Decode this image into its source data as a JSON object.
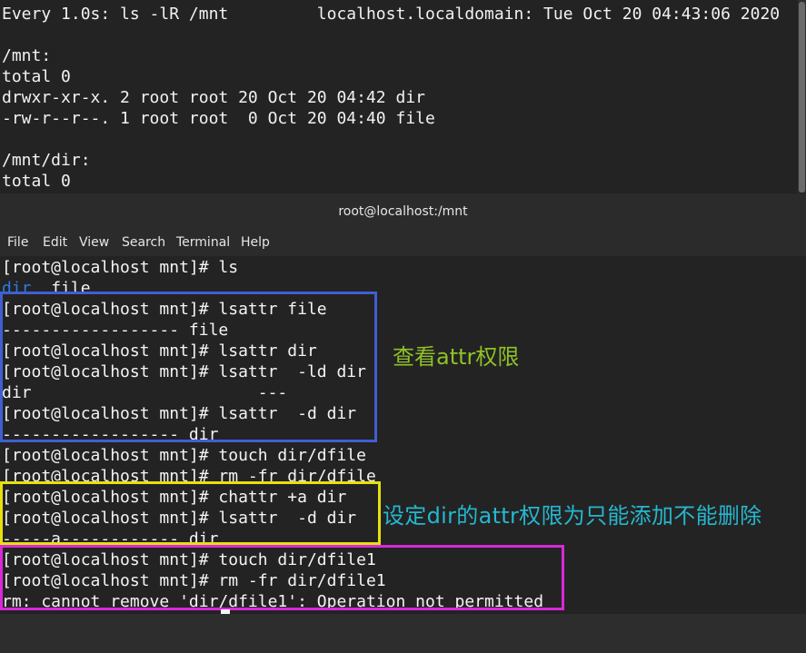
{
  "watch_terminal": {
    "lines": [
      "Every 1.0s: ls -lR /mnt         localhost.localdomain: Tue Oct 20 04:43:06 2020",
      "",
      "/mnt:",
      "total 0",
      "drwxr-xr-x. 2 root root 20 Oct 20 04:42 dir",
      "-rw-r--r--. 1 root root  0 Oct 20 04:40 file",
      "",
      "/mnt/dir:",
      "total 0"
    ]
  },
  "window": {
    "title": "root@localhost:/mnt",
    "menu": [
      "File",
      "Edit",
      "View",
      "Search",
      "Terminal",
      "Help"
    ]
  },
  "terminal": {
    "prompt_ls": "[root@localhost mnt]# ls",
    "ls_output": {
      "dir": "dir",
      "file": "  file"
    },
    "lines": [
      "[root@localhost mnt]# lsattr file",
      "------------------ file",
      "[root@localhost mnt]# lsattr dir",
      "[root@localhost mnt]# lsattr  -ld dir",
      "dir                       ---",
      "[root@localhost mnt]# lsattr  -d dir",
      "------------------ dir",
      "[root@localhost mnt]# touch dir/dfile",
      "[root@localhost mnt]# rm -fr dir/dfile",
      "[root@localhost mnt]# chattr +a dir",
      "[root@localhost mnt]# lsattr  -d dir",
      "-----a------------ dir",
      "[root@localhost mnt]# touch dir/dfile1",
      "[root@localhost mnt]# rm -fr dir/dfile1",
      "rm: cannot remove 'dir/dfile1': Operation not permitted"
    ]
  },
  "annotations": {
    "note_view": "查看attr权限",
    "note_set": "设定dir的attr权限为只能添加不能删除"
  },
  "colors": {
    "box_blue": "#3f5fd1",
    "box_yellow": "#e8e00c",
    "box_magenta": "#d82ad8",
    "note_green": "#8fc126",
    "note_cyan": "#25b7cf",
    "dir_blue": "#2c7be6"
  }
}
